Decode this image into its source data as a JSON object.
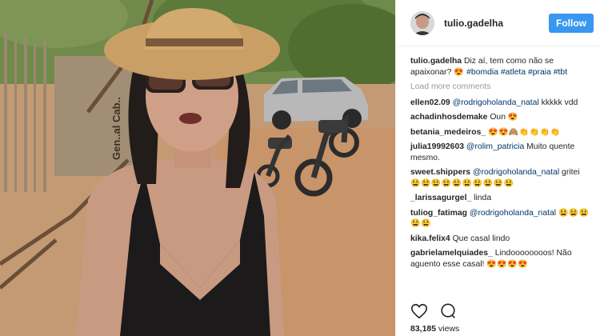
{
  "post": {
    "username": "tulio.gadelha",
    "follow_label": "Follow",
    "caption_user": "tulio.gadelha",
    "caption_text": "Diz aí, tem como não se apaixonar?",
    "caption_emoji": "😍",
    "caption_tags": "#bomdia #atleta #praia #tbt",
    "load_more": "Load more comments",
    "views_count": "83,185",
    "views_label": "views",
    "photo_sign": "Gen..al Cab.."
  },
  "comments": [
    {
      "user": "ellen02.09",
      "mention": "@rodrigoholanda_natal",
      "text": "kkkkk vdd",
      "emoji": ""
    },
    {
      "user": "achadinhosdemake",
      "mention": "",
      "text": "Oun",
      "emoji": "😍"
    },
    {
      "user": "betania_medeiros_",
      "mention": "",
      "text": "",
      "emoji": "😍😍🙈👏👏👏👏"
    },
    {
      "user": "julia19992603",
      "mention": "@rolim_patricia",
      "text": "Muito quente mesmo.",
      "emoji": ""
    },
    {
      "user": "sweet.shippers",
      "mention": "@rodrigoholanda_natal",
      "text": "gritei",
      "emoji": "😫😫😫😫😫😫😫😫😫😫"
    },
    {
      "user": "_larissagurgel_",
      "mention": "",
      "text": "linda",
      "emoji": ""
    },
    {
      "user": "tuliog_fatimag",
      "mention": "@rodrigoholanda_natal",
      "text": "",
      "emoji": "😫😫😫😫😫"
    },
    {
      "user": "kika.felix4",
      "mention": "",
      "text": "Que casal lindo",
      "emoji": ""
    },
    {
      "user": "gabrielamelquiades_",
      "mention": "",
      "text": "Lindoooooooos! Não aguento esse casal!",
      "emoji": "😍😍😍😍"
    }
  ],
  "icons": {
    "like": "heart-icon",
    "comment": "comment-icon"
  },
  "colors": {
    "follow_button": "#3897f0",
    "mention": "#003569",
    "muted": "#999999"
  }
}
